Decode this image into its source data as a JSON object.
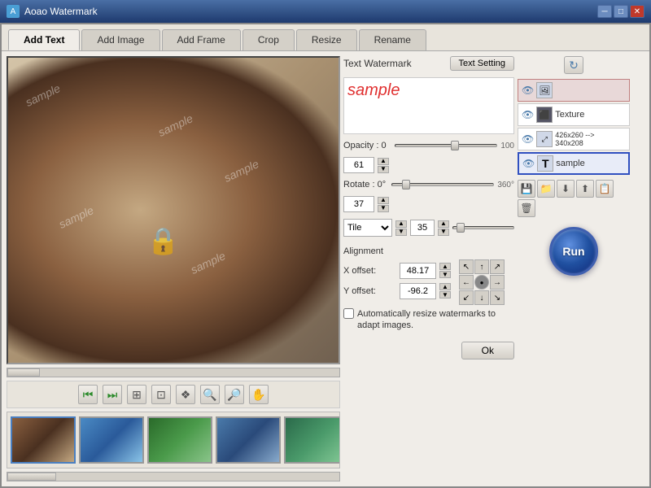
{
  "window": {
    "title": "Aoao Watermark",
    "min_btn": "─",
    "max_btn": "□",
    "close_btn": "✕"
  },
  "tabs": [
    {
      "label": "Add Text",
      "active": true
    },
    {
      "label": "Add Image",
      "active": false
    },
    {
      "label": "Add Frame",
      "active": false
    },
    {
      "label": "Crop",
      "active": false
    },
    {
      "label": "Resize",
      "active": false
    },
    {
      "label": "Rename",
      "active": false
    }
  ],
  "panel": {
    "header": "Text Watermark",
    "text_setting_btn": "Text Setting",
    "preview_text": "sample",
    "opacity_label": "Opacity : 0",
    "opacity_max": "100",
    "opacity_value": "61",
    "rotate_label": "Rotate : 0°",
    "rotate_max": "360°",
    "rotate_value": "37",
    "tile_label": "Tile",
    "tile_value": "35",
    "alignment_label": "Alignment",
    "x_offset_label": "X offset:",
    "x_offset_value": "48.17",
    "y_offset_label": "Y offset:",
    "y_offset_value": "-96.2",
    "checkbox_label": "Automatically resize watermarks to adapt images.",
    "ok_btn": "Ok"
  },
  "layers": [
    {
      "id": 1,
      "type": "image",
      "label": "",
      "selected": false,
      "highlighted": true,
      "icon": "🖼"
    },
    {
      "id": 2,
      "type": "texture",
      "label": "Texture",
      "selected": false,
      "highlighted": false,
      "icon": "⬛"
    },
    {
      "id": 3,
      "type": "resize",
      "label": "426x260 --> 340x208",
      "selected": false,
      "highlighted": false,
      "icon": "⤢"
    },
    {
      "id": 4,
      "type": "text",
      "label": "sample",
      "selected": true,
      "highlighted": false,
      "icon": "T"
    }
  ],
  "layer_tools": [
    "💾",
    "📁",
    "⬇",
    "⬆",
    "📋",
    "🗑"
  ],
  "run_btn": "Run",
  "thumbnails": [
    {
      "color": "thumb-1"
    },
    {
      "color": "thumb-2"
    },
    {
      "color": "thumb-3"
    },
    {
      "color": "thumb-4"
    },
    {
      "color": "thumb-5"
    }
  ],
  "toolbar_icons": [
    {
      "name": "skip-back",
      "symbol": "⏮"
    },
    {
      "name": "skip-forward",
      "symbol": "⏭"
    },
    {
      "name": "fit-window",
      "symbol": "⊞"
    },
    {
      "name": "actual-size",
      "symbol": "⊡"
    },
    {
      "name": "add-watermark",
      "symbol": "❖"
    },
    {
      "name": "zoom-in",
      "symbol": "🔍"
    },
    {
      "name": "zoom-out",
      "symbol": "🔎"
    },
    {
      "name": "pan",
      "symbol": "✋"
    }
  ]
}
